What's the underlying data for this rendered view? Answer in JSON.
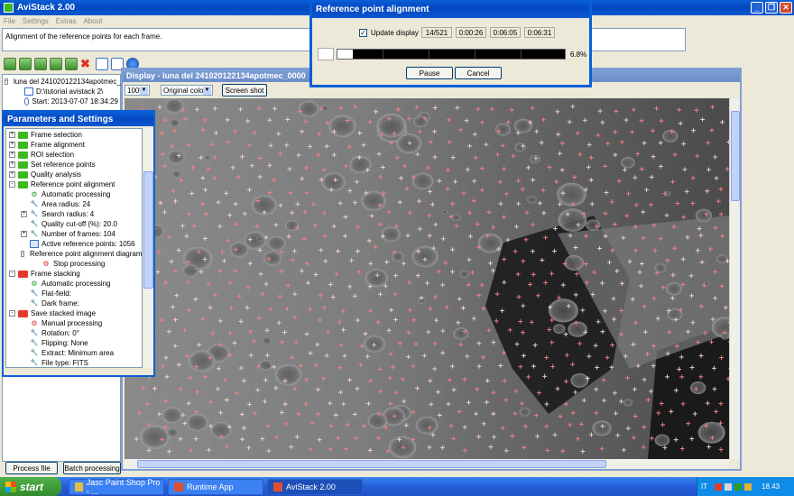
{
  "main_window": {
    "title": "AviStack 2.00",
    "menu": [
      "File",
      "Settings",
      "Extras",
      "About"
    ],
    "status_message": "Alignment of the reference points for each frame.",
    "tree": {
      "root": "luna del 241020122134apotmec_0000",
      "path": "D:\\tutorial avistack 2\\",
      "start": "Start: 2013-07-07 18:34:29"
    },
    "bottom_buttons": [
      "Process file",
      "Batch processing"
    ]
  },
  "params_panel": {
    "title": "Parameters and Settings",
    "items": [
      {
        "label": "Frame selection",
        "level": 0,
        "icon": "green-folder",
        "exp": "+"
      },
      {
        "label": "Frame alignment",
        "level": 0,
        "icon": "green-folder",
        "exp": "+"
      },
      {
        "label": "ROI selection",
        "level": 0,
        "icon": "green-folder",
        "exp": "+"
      },
      {
        "label": "Set reference points",
        "level": 0,
        "icon": "green-folder",
        "exp": "+"
      },
      {
        "label": "Quality analysis",
        "level": 0,
        "icon": "green-folder",
        "exp": "+"
      },
      {
        "label": "Reference point alignment",
        "level": 0,
        "icon": "green-folder",
        "exp": "-"
      },
      {
        "label": "Automatic processing",
        "level": 1,
        "icon": "gear-green",
        "exp": ""
      },
      {
        "label": "Area radius: 24",
        "level": 1,
        "icon": "wrench",
        "exp": ""
      },
      {
        "label": "Search radius: 4",
        "level": 1,
        "icon": "wrench",
        "exp": "+"
      },
      {
        "label": "Quality cut-off (%): 20.0",
        "level": 1,
        "icon": "wrench",
        "exp": ""
      },
      {
        "label": "Number of frames: 104",
        "level": 1,
        "icon": "wrench",
        "exp": "+"
      },
      {
        "label": "Active reference points: 1056",
        "level": 1,
        "icon": "doc",
        "exp": ""
      },
      {
        "label": "Reference point alignment diagram",
        "level": 1,
        "icon": "red-folder",
        "exp": "-"
      },
      {
        "label": "Stop processing",
        "level": 2,
        "icon": "gear-red",
        "exp": ""
      },
      {
        "label": "Frame stacking",
        "level": 0,
        "icon": "red-folder",
        "exp": "-"
      },
      {
        "label": "Automatic processing",
        "level": 1,
        "icon": "gear-green",
        "exp": ""
      },
      {
        "label": "Flat-field:",
        "level": 1,
        "icon": "wrench",
        "exp": ""
      },
      {
        "label": "Dark frame:",
        "level": 1,
        "icon": "wrench",
        "exp": ""
      },
      {
        "label": "Save stacked image",
        "level": 0,
        "icon": "red-folder",
        "exp": "-"
      },
      {
        "label": "Manual processing",
        "level": 1,
        "icon": "gear-red",
        "exp": ""
      },
      {
        "label": "Rotation: 0°",
        "level": 1,
        "icon": "wrench",
        "exp": ""
      },
      {
        "label": "Flipping: None",
        "level": 1,
        "icon": "wrench",
        "exp": ""
      },
      {
        "label": "Extract: Minimum area",
        "level": 1,
        "icon": "wrench",
        "exp": ""
      },
      {
        "label": "File type: FITS",
        "level": 1,
        "icon": "wrench",
        "exp": ""
      }
    ]
  },
  "display_window": {
    "title": "Display - luna del 241020122134apotmec_0000",
    "zoom": "100%",
    "color_mode": "Original color",
    "screenshot_label": "Screen shot"
  },
  "dialog": {
    "title": "Reference point alignment",
    "update_display_label": "Update display",
    "update_display_checked": true,
    "frame_counter": "14/521",
    "elapsed": "0:00:26",
    "remaining": "0:06:05",
    "total": "0:06:31",
    "percent_text": "6.8%",
    "progress_fraction": 0.068,
    "pause_label": "Pause",
    "cancel_label": "Cancel"
  },
  "taskbar": {
    "start_label": "start",
    "items": [
      "Jasc Paint Shop Pro - ...",
      "Runtime App",
      "AviStack 2.00"
    ],
    "lang": "IT",
    "clock": "18.43"
  }
}
